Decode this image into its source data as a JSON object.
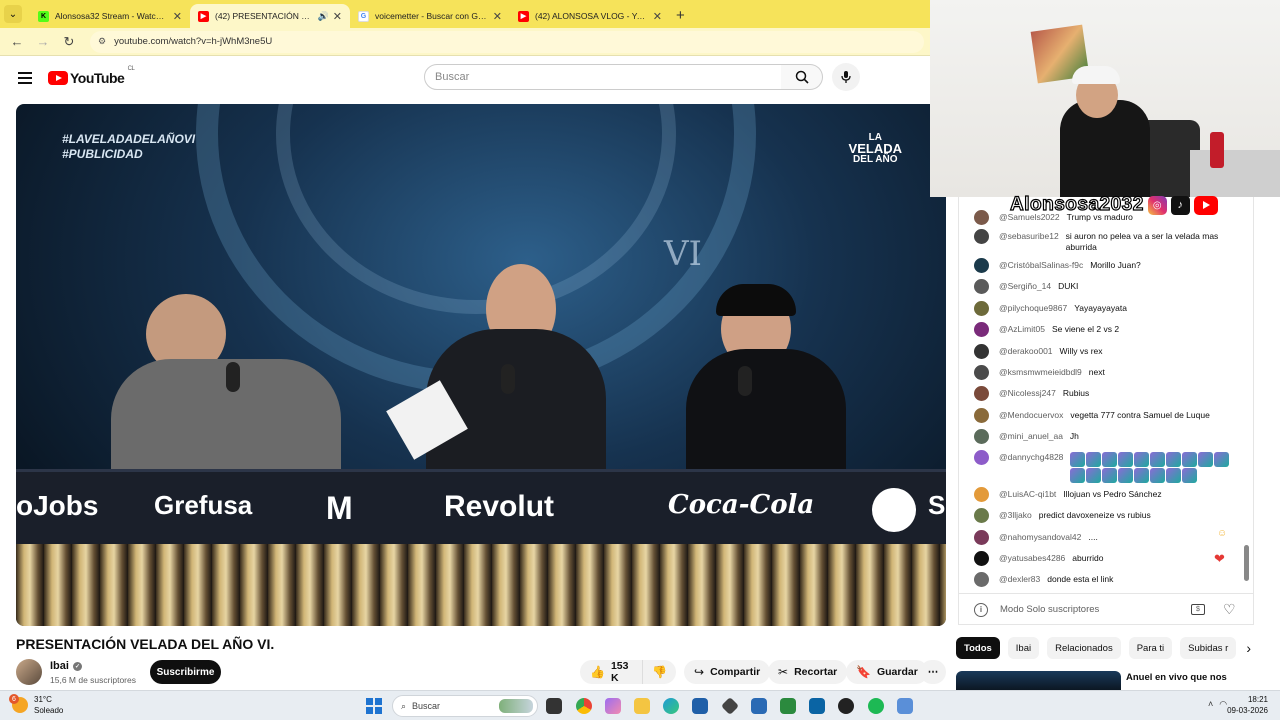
{
  "browser": {
    "tabs": [
      {
        "label": "Alonsosa32 Stream - Watch Live",
        "favicon": "kick",
        "active": false
      },
      {
        "label": "(42) PRESENTACIÓN VELADA DEL AÑO VI.",
        "favicon": "youtube",
        "active": true,
        "audio": true
      },
      {
        "label": "voicemetter - Buscar con Google",
        "favicon": "google",
        "active": false
      },
      {
        "label": "(42) ALONSOSA VLOG - YouTube",
        "favicon": "youtube",
        "active": false
      }
    ],
    "url": "youtube.com/watch?v=h-jWhM3ne5U"
  },
  "youtube": {
    "logo_text": "YouTube",
    "country_code": "CL",
    "search_placeholder": "Buscar"
  },
  "video": {
    "overlay_hashtag_1": "#LAVELADADELAÑOVI",
    "overlay_hashtag_2": "#PUBLICIDAD",
    "overlay_logo_1": "LA",
    "overlay_logo_2": "VELADA",
    "overlay_logo_3": "DEL AÑO",
    "roman": "VI",
    "sponsors": [
      "oJobs",
      "Grefusa",
      "M",
      "Revolut",
      "Coca-Cola",
      "S"
    ],
    "title": "PRESENTACIÓN VELADA DEL AÑO VI.",
    "channel": "Ibai",
    "subscribers": "15,6 M de suscriptores",
    "subscribe_label": "Suscribirme",
    "likes": "153 K",
    "share_label": "Compartir",
    "clip_label": "Recortar",
    "save_label": "Guardar"
  },
  "streamer_overlay": {
    "handle": "Alonsosa2032"
  },
  "chat": {
    "messages": [
      {
        "author": "@Samuels2022",
        "text": "Trump vs maduro",
        "color": "#7b5a4a"
      },
      {
        "author": "@sebasuribe12",
        "text": "si auron no pelea va a ser la velada mas aburrida",
        "color": "#444"
      },
      {
        "author": "@CristóbalSalinas-f9c",
        "text": "Morillo Juan?",
        "color": "#1b3a4b"
      },
      {
        "author": "@Sergiño_14",
        "text": "DUKI",
        "color": "#5a5a5a"
      },
      {
        "author": "@pilychoque9867",
        "text": "Yayayayayata",
        "color": "#6d6a3a"
      },
      {
        "author": "@AzLimit05",
        "text": "Se viene el 2 vs 2",
        "color": "#7a2b7a"
      },
      {
        "author": "@derakoo001",
        "text": "Willy vs rex",
        "color": "#333"
      },
      {
        "author": "@ksmsmwmeieidbdl9",
        "text": "next",
        "color": "#4b4b4b"
      },
      {
        "author": "@Nicolessj247",
        "text": "Rubius",
        "color": "#7a4a3a"
      },
      {
        "author": "@Mendocuervox",
        "text": "vegetta 777 contra Samuel de Luque",
        "color": "#8a6a3a"
      },
      {
        "author": "@mini_anuel_aa",
        "text": "Jh",
        "color": "#5b6b5b"
      },
      {
        "author": "@dannychg4828",
        "text": "",
        "color": "#8d5cc9"
      },
      {
        "author": "@LuisAC-qi1bt",
        "text": "Illojuan vs Pedro Sánchez",
        "color": "#e39a3a"
      },
      {
        "author": "@3lljako",
        "text": "predict davoxeneize vs rubius",
        "color": "#6a7a4a"
      },
      {
        "author": "@nahomysandoval42",
        "text": "....",
        "color": "#7a3a5a"
      },
      {
        "author": "@yatusabes4286",
        "text": "aburrido",
        "color": "#111"
      },
      {
        "author": "@dexler83",
        "text": "donde esta el link",
        "color": "#6a6a6a"
      }
    ],
    "input_placeholder": "Modo Solo suscriptores"
  },
  "chips": [
    "Todos",
    "Ibai",
    "Relacionados",
    "Para ti",
    "Subidas r"
  ],
  "recommendation": {
    "title": "Anuel en vivo que nos"
  },
  "taskbar": {
    "temperature": "31°C",
    "condition": "Soleado",
    "weather_badge": "6",
    "search_label": "Buscar",
    "time": "18:21",
    "date": "09-03-2026"
  },
  "colors": {
    "tabstrip": "#f6e35a",
    "subscribe": "#0f0f0f",
    "youtube_red": "#ff0000"
  }
}
